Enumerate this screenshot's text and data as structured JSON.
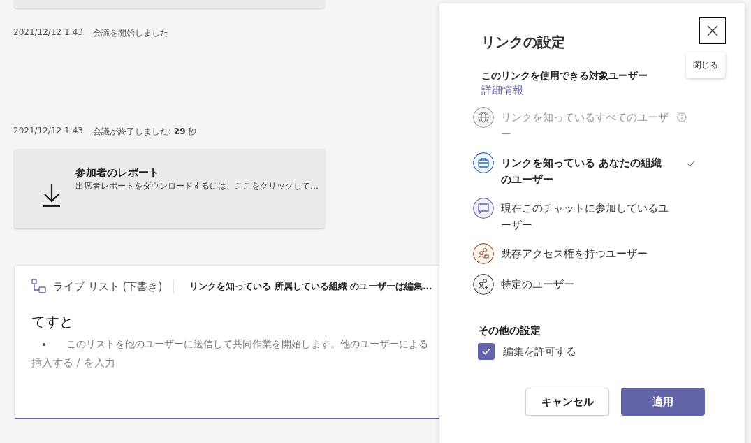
{
  "timeline": [
    {
      "time": "2021/12/12 1:43",
      "text": "会議を開始しました"
    },
    {
      "time": "2021/12/12 1:43",
      "text": "会議が終了しました: **29** 秒"
    }
  ],
  "report_card": {
    "title": "参加者のレポート",
    "subtitle": "出席者レポートをダウンロードするには、ここをクリックして…"
  },
  "live_list": {
    "title": "ライブ リスト (下書き)",
    "permission": "リンクを知っている 所属している組織 のユーザーは編集…",
    "heading": "てすと",
    "bullets": [
      "このリストを他のユーザーに送信して共同作業を開始します。他のユーザーによる"
    ],
    "placeholder": "挿入する / を入力"
  },
  "link_settings": {
    "title": "リンクの設定",
    "close_tooltip": "閉じる",
    "audience_label": "このリンクを使用できる対象ユーザー",
    "learn_more": "詳細情報",
    "options": [
      {
        "kind": "globe",
        "label": "リンクを知っているすべてのユーザー",
        "selected": false,
        "disabled": true,
        "info": true
      },
      {
        "kind": "organization",
        "label": "リンクを知っている あなたの組織のユーザー",
        "selected": true,
        "disabled": false,
        "info": false
      },
      {
        "kind": "chat",
        "label": "現在このチャットに参加しているユーザー",
        "selected": false,
        "disabled": false,
        "info": false
      },
      {
        "kind": "existing",
        "label": "既存アクセス権を持つユーザー",
        "selected": false,
        "disabled": false,
        "info": false
      },
      {
        "kind": "specific",
        "label": "特定のユーザー",
        "selected": false,
        "disabled": false,
        "info": false
      }
    ],
    "other_title": "その他の設定",
    "allow_edit": {
      "label": "編集を許可する",
      "checked": true
    },
    "buttons": [
      {
        "label": "キャンセル",
        "kind": "secondary"
      },
      {
        "label": "適用",
        "kind": "primary"
      }
    ]
  }
}
